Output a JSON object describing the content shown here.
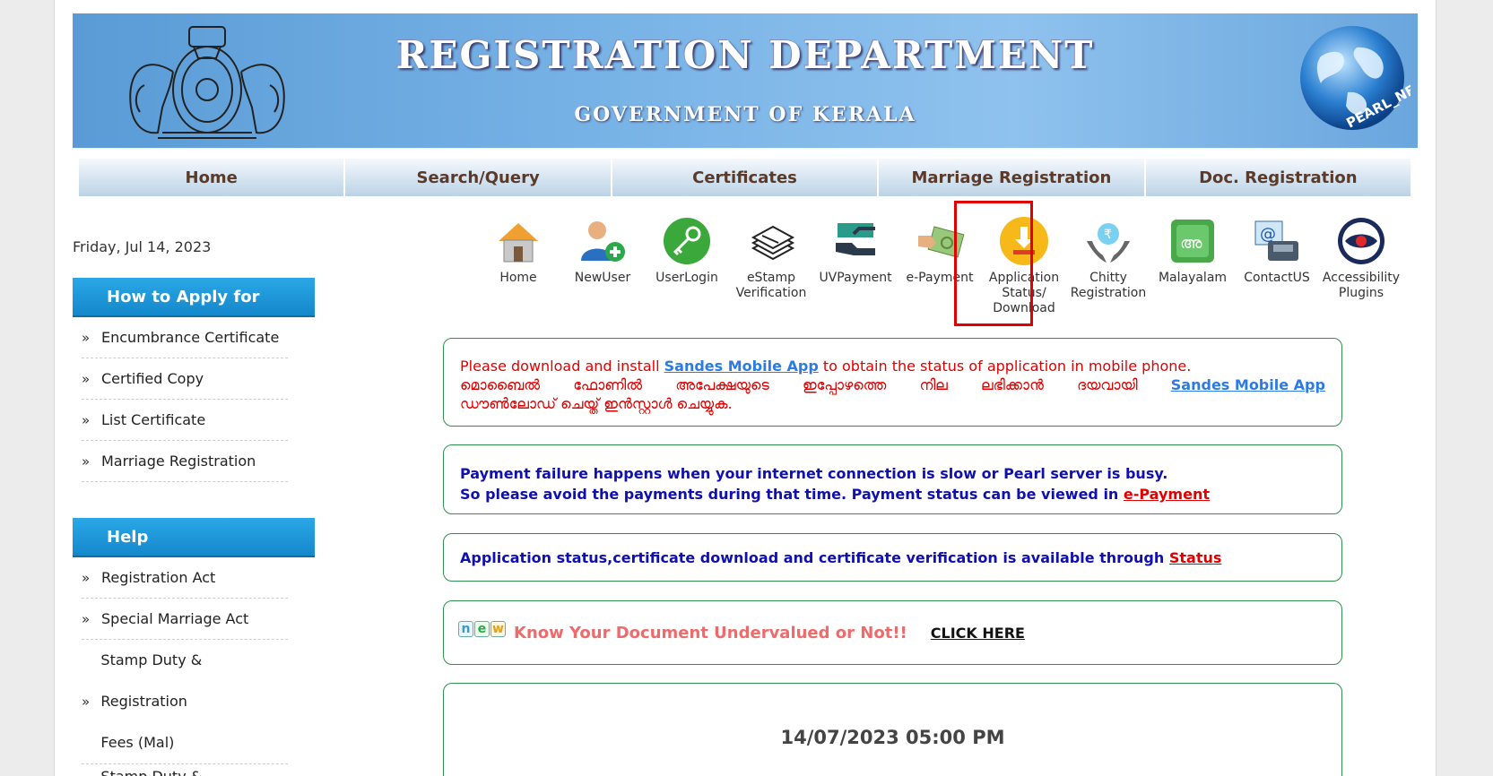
{
  "banner": {
    "title": "REGISTRATION DEPARTMENT",
    "subtitle": "GOVERNMENT OF KERALA",
    "globe_text": "PEARL_NET",
    "colors": {
      "banner": "#78b3e6"
    }
  },
  "nav": [
    {
      "label": "Home"
    },
    {
      "label": "Search/Query"
    },
    {
      "label": "Certificates"
    },
    {
      "label": "Marriage Registration"
    },
    {
      "label": "Doc. Registration"
    }
  ],
  "date": "Friday, Jul 14, 2023",
  "sidebar": {
    "apply_title": "How to Apply for",
    "apply_items": [
      {
        "label": "Encumbrance Certificate"
      },
      {
        "label": "Certified Copy"
      },
      {
        "label": "List Certificate"
      },
      {
        "label": "Marriage Registration"
      }
    ],
    "help_title": "Help",
    "help_items": [
      {
        "label": "Registration Act"
      },
      {
        "label": "Special Marriage Act"
      },
      {
        "label_line1": "Stamp Duty & Registration",
        "label_line2": "Fees (Mal)"
      },
      {
        "label": "Stamp Duty & Registration"
      }
    ]
  },
  "icons": [
    {
      "icon": "home-icon",
      "line1": "Home",
      "line2": "",
      "line3": ""
    },
    {
      "icon": "new-user-icon",
      "line1": "NewUser",
      "line2": "",
      "line3": ""
    },
    {
      "icon": "key-icon",
      "line1": "UserLogin",
      "line2": "",
      "line3": ""
    },
    {
      "icon": "stamp-papers-icon",
      "line1": "eStamp",
      "line2": "Verification",
      "line3": ""
    },
    {
      "icon": "hand-payment-icon",
      "line1": "UVPayment",
      "line2": "",
      "line3": ""
    },
    {
      "icon": "cash-hand-icon",
      "line1": "e-Payment",
      "line2": "",
      "line3": ""
    },
    {
      "icon": "download-icon",
      "line1": "Application",
      "line2": "Status/",
      "line3": "Download"
    },
    {
      "icon": "money-bag-hands-icon",
      "line1": "Chitty",
      "line2": "Registration",
      "line3": ""
    },
    {
      "icon": "malayalam-icon",
      "line1": "Malayalam",
      "line2": "",
      "line3": ""
    },
    {
      "icon": "phone-email-icon",
      "line1": "ContactUS",
      "line2": "",
      "line3": ""
    },
    {
      "icon": "eye-icon",
      "line1": "Accessibility",
      "line2": "Plugins",
      "line3": ""
    }
  ],
  "notices": {
    "sandes": {
      "en_pre": "Please download and install ",
      "link": "Sandes Mobile App",
      "en_post": " to obtain the status of application in mobile phone.",
      "ml_words": [
        "മൊബൈൽ",
        "ഫോണിൽ",
        "അപേക്ഷയുടെ",
        "ഇപ്പോഴത്തെ",
        "നില",
        "ലഭിക്കാൻ",
        "ദയവായി"
      ],
      "ml_link": "Sandes Mobile App",
      "ml_line2": "ഡൗൺലോഡ് ചെയ്ത് ഇൻസ്റ്റാൾ ചെയ്യുക."
    },
    "payment": {
      "line1": "Payment failure happens when your internet connection is slow or Pearl server is busy.",
      "line2_pre": "So please avoid the payments during that time. Payment status can be viewed in ",
      "link": "e-Payment"
    },
    "status": {
      "text": "Application status,certificate download and certificate verification is available through ",
      "link": "Status"
    },
    "undervalued": {
      "badge": [
        "n",
        "e",
        "w"
      ],
      "text": "Know Your Document Undervalued or Not!!",
      "link": "CLICK HERE"
    },
    "datetime": "14/07/2023 05:00 PM"
  }
}
